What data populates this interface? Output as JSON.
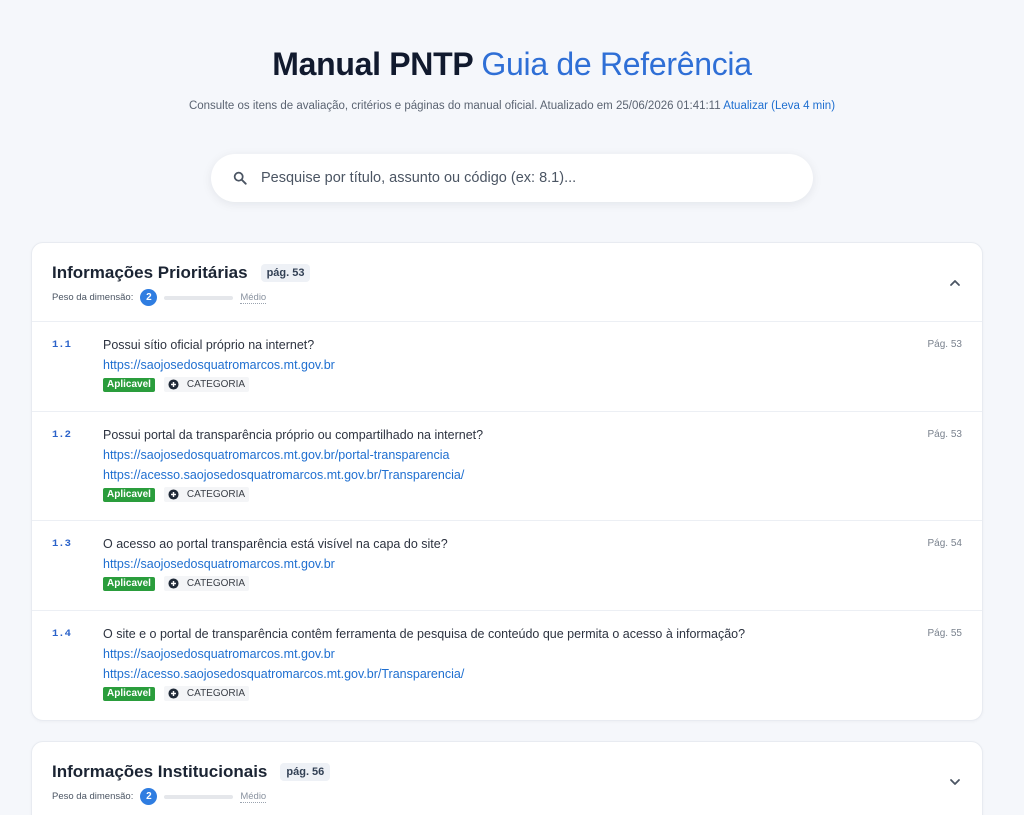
{
  "header": {
    "title_strong": "Manual PNTP",
    "title_light": "Guia de Referência",
    "subtitle": "Consulte os itens de avaliação, critérios e páginas do manual oficial. Atualizado em 25/06/2026 01:41:11",
    "update_link": "Atualizar (Leva 4 min)"
  },
  "search": {
    "placeholder": "Pesquise por título, assunto ou código (ex: 8.1)...",
    "icon": "search-icon"
  },
  "colors": {
    "accent": "#2f6fd6",
    "link": "#1f6fd0",
    "applicable": "#2a9d3c",
    "weight": "#2f7de1"
  },
  "weight_label": "Peso da dimensão:",
  "sections": [
    {
      "title": "Informações Prioritárias",
      "page": "pág. 53",
      "weight": "2",
      "weight_level": 0.5,
      "weight_text": "Médio",
      "expanded": true,
      "items": [
        {
          "code": "1.1",
          "question": "Possui sítio oficial próprio na internet?",
          "links": [
            "https://saojosedosquatromarcos.mt.gov.br"
          ],
          "status": "Aplicavel",
          "category": "CATEGORIA",
          "page": "Pág. 53"
        },
        {
          "code": "1.2",
          "question": "Possui portal da transparência próprio ou compartilhado na internet?",
          "links": [
            "https://saojosedosquatromarcos.mt.gov.br/portal-transparencia",
            "https://acesso.saojosedosquatromarcos.mt.gov.br/Transparencia/"
          ],
          "status": "Aplicavel",
          "category": "CATEGORIA",
          "page": "Pág. 53"
        },
        {
          "code": "1.3",
          "question": "O acesso ao portal transparência está visível na capa do site?",
          "links": [
            "https://saojosedosquatromarcos.mt.gov.br"
          ],
          "status": "Aplicavel",
          "category": "CATEGORIA",
          "page": "Pág. 54"
        },
        {
          "code": "1.4",
          "question": "O site e o portal de transparência contêm ferramenta de pesquisa de conteúdo que permita o acesso à informação?",
          "links": [
            "https://saojosedosquatromarcos.mt.gov.br",
            "https://acesso.saojosedosquatromarcos.mt.gov.br/Transparencia/"
          ],
          "status": "Aplicavel",
          "category": "CATEGORIA",
          "page": "Pág. 55"
        }
      ]
    },
    {
      "title": "Informações Institucionais",
      "page": "pág. 56",
      "weight": "2",
      "weight_level": 0.5,
      "weight_text": "Médio",
      "expanded": false
    }
  ]
}
